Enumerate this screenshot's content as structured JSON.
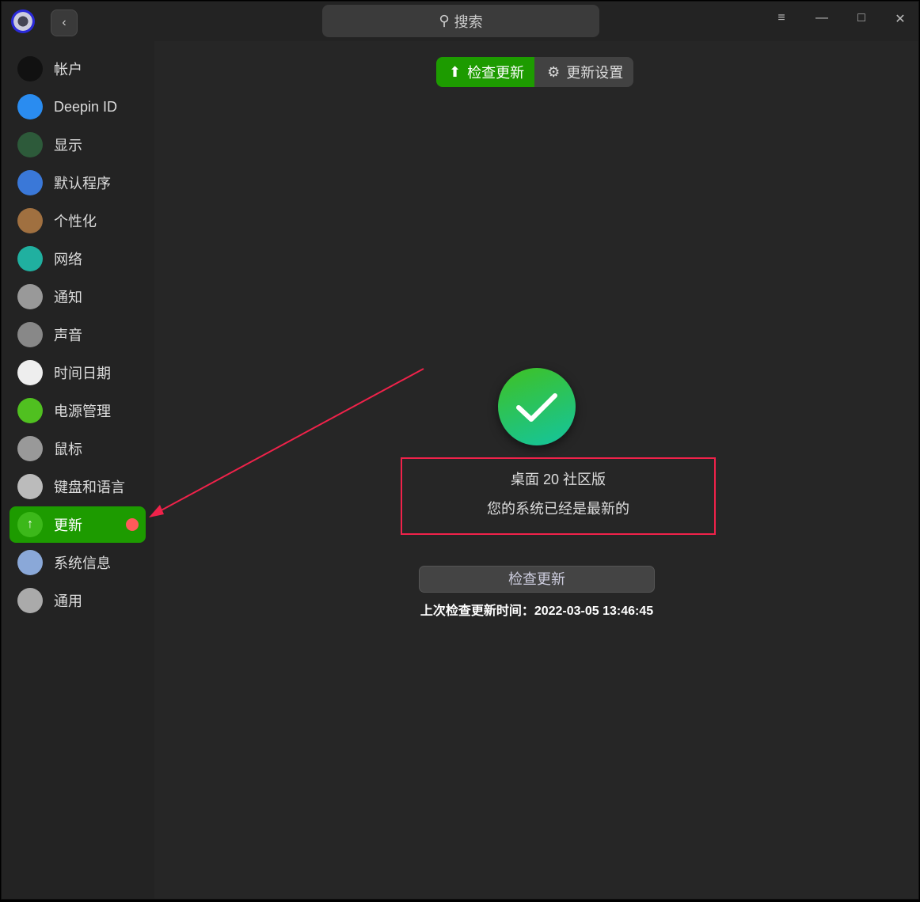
{
  "titlebar": {
    "search_label": "搜索"
  },
  "sidebar": {
    "items": [
      {
        "label": "帐户",
        "icon": "account-icon",
        "color": "#111"
      },
      {
        "label": "Deepin ID",
        "icon": "cloud-icon",
        "color": "#2a8cf0"
      },
      {
        "label": "显示",
        "icon": "display-icon",
        "color": "#2d5a3a"
      },
      {
        "label": "默认程序",
        "icon": "default-apps-icon",
        "color": "#3a78d8"
      },
      {
        "label": "个性化",
        "icon": "palette-icon",
        "color": "#a07040"
      },
      {
        "label": "网络",
        "icon": "network-icon",
        "color": "#20b0a0"
      },
      {
        "label": "通知",
        "icon": "bell-icon",
        "color": "#999"
      },
      {
        "label": "声音",
        "icon": "speaker-icon",
        "color": "#888"
      },
      {
        "label": "时间日期",
        "icon": "clock-icon",
        "color": "#eee"
      },
      {
        "label": "电源管理",
        "icon": "battery-icon",
        "color": "#50c020"
      },
      {
        "label": "鼠标",
        "icon": "mouse-icon",
        "color": "#999"
      },
      {
        "label": "键盘和语言",
        "icon": "keyboard-icon",
        "color": "#bbb"
      },
      {
        "label": "更新",
        "icon": "update-icon",
        "color": "#3cb81a"
      },
      {
        "label": "系统信息",
        "icon": "system-info-icon",
        "color": "#8aa8d8"
      },
      {
        "label": "通用",
        "icon": "gear-icon",
        "color": "#aaa"
      }
    ]
  },
  "main": {
    "tabs": [
      {
        "label": "检查更新"
      },
      {
        "label": "更新设置"
      }
    ],
    "edition": "桌面 20 社区版",
    "status": "您的系统已经是最新的",
    "check_button": "检查更新",
    "last_check": "上次检查更新时间：2022-03-05 13:46:45"
  }
}
